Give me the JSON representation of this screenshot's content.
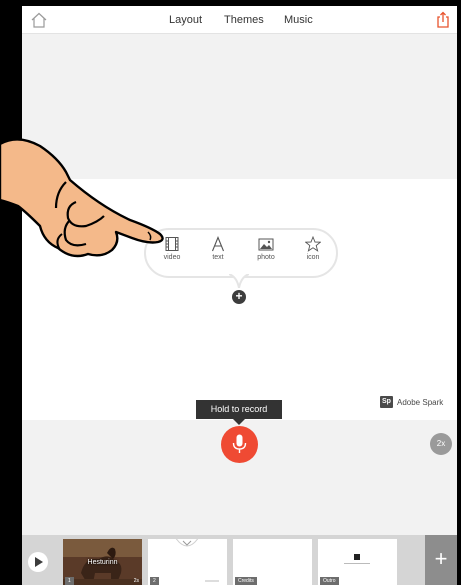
{
  "topbar": {
    "tabs": [
      "Layout",
      "Themes",
      "Music"
    ]
  },
  "content_options": [
    {
      "label": "video",
      "icon": "video-icon"
    },
    {
      "label": "text",
      "icon": "text-icon"
    },
    {
      "label": "photo",
      "icon": "photo-icon"
    },
    {
      "label": "icon",
      "icon": "star-icon"
    }
  ],
  "add_button": "+",
  "watermark": {
    "logo": "Sp",
    "text": "Adobe Spark"
  },
  "record": {
    "tooltip": "Hold to record"
  },
  "speed_badge": "2x",
  "slides": [
    {
      "badge": "1",
      "title": "Hesturinn",
      "duration": "2s"
    },
    {
      "badge": "2",
      "title": "",
      "duration": ""
    },
    {
      "badge": "Credits",
      "title": "",
      "duration": ""
    },
    {
      "badge": "Outro",
      "title": "",
      "duration": ""
    }
  ],
  "add_slide": "+",
  "colors": {
    "record": "#ef4a33",
    "share": "#e8532d",
    "chrome": "#f2f2f2"
  }
}
